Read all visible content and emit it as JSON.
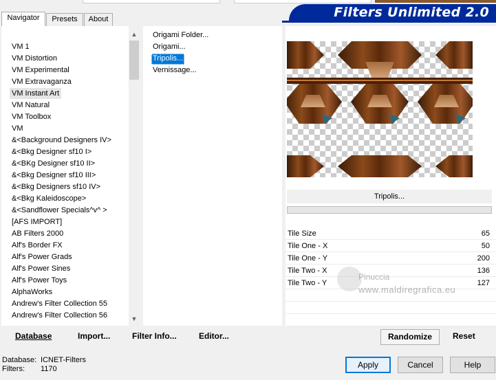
{
  "window": {
    "banner_title": "Filters Unlimited 2.0"
  },
  "tabs": [
    {
      "label": "Navigator",
      "active": true
    },
    {
      "label": "Presets",
      "active": false
    },
    {
      "label": "About",
      "active": false
    }
  ],
  "categories": [
    "VM 1",
    "VM Distortion",
    "VM Experimental",
    "VM Extravaganza",
    "VM Instant Art",
    "VM Natural",
    "VM Toolbox",
    "VM",
    "&<Background Designers IV>",
    "&<Bkg Designer sf10 I>",
    "&<BKg Designer sf10 II>",
    "&<Bkg Designer sf10 III>",
    "&<Bkg Designers sf10 IV>",
    "&<Bkg Kaleidoscope>",
    "&<Sandflower Specials^v^ >",
    "[AFS IMPORT]",
    "AB Filters 2000",
    "Alf's Border FX",
    "Alf's Power Grads",
    "Alf's Power Sines",
    "Alf's Power Toys",
    "AlphaWorks",
    "Andrew's Filter Collection 55",
    "Andrew's Filter Collection 56"
  ],
  "category_highlighted_index": 4,
  "filters": [
    {
      "label": "Origami Folder...",
      "selected": false
    },
    {
      "label": "Origami...",
      "selected": false
    },
    {
      "label": "Tripolis...",
      "selected": true
    },
    {
      "label": "Vernissage...",
      "selected": false
    }
  ],
  "preview": {
    "filter_name": "Tripolis..."
  },
  "params": [
    {
      "label": "Tile Size",
      "value": "65"
    },
    {
      "label": "Tile One - X",
      "value": "50"
    },
    {
      "label": "Tile One - Y",
      "value": "200"
    },
    {
      "label": "Tile Two - X",
      "value": "136"
    },
    {
      "label": "Tile Two - Y",
      "value": "127"
    }
  ],
  "toolbar": {
    "database": "Database",
    "import": "Import...",
    "filter_info": "Filter Info...",
    "editor": "Editor...",
    "randomize": "Randomize",
    "reset": "Reset"
  },
  "status": {
    "database_label": "Database:",
    "database_value": "ICNET-Filters",
    "filters_label": "Filters:",
    "filters_value": "1170"
  },
  "dialog": {
    "apply": "Apply",
    "cancel": "Cancel",
    "help": "Help"
  },
  "watermark": {
    "name": "Pinuccia",
    "url": "www.maldiregrafica.eu"
  }
}
